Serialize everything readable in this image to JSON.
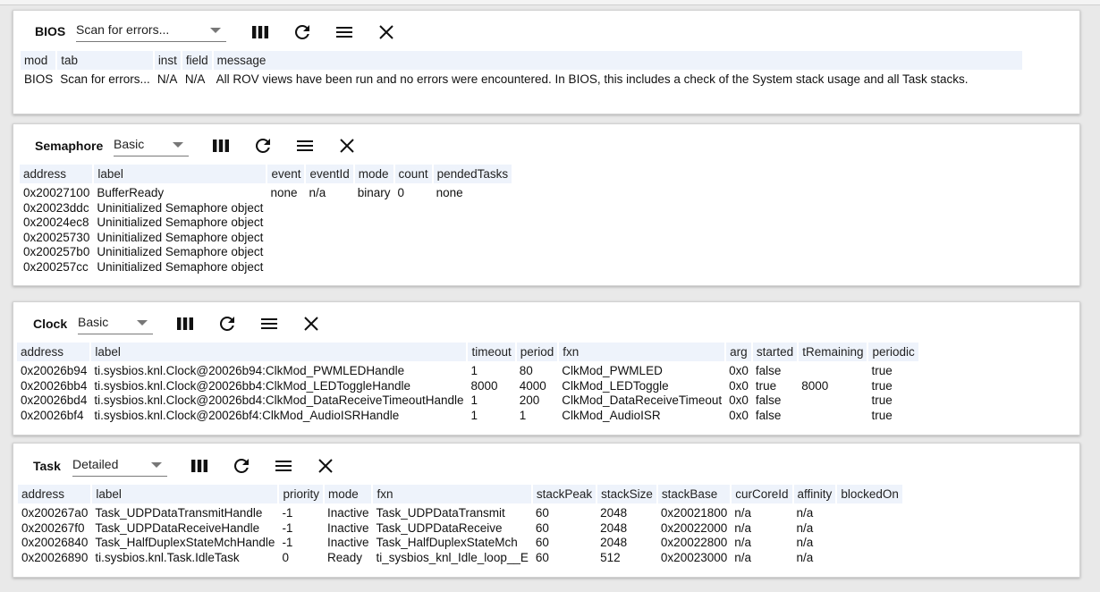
{
  "panels": {
    "bios": {
      "title": "BIOS",
      "view": "Scan for errors...",
      "columns": [
        "mod",
        "tab",
        "inst",
        "field",
        "message"
      ],
      "rows": [
        [
          "BIOS",
          "Scan for errors...",
          "N/A",
          "N/A",
          "All ROV views have been run and no errors were encountered. In BIOS, this includes a check of the System stack usage and all Task stacks."
        ]
      ]
    },
    "semaphore": {
      "title": "Semaphore",
      "view": "Basic",
      "columns": [
        "address",
        "label",
        "event",
        "eventId",
        "mode",
        "count",
        "pendedTasks"
      ],
      "rows": [
        [
          "0x20027100",
          "BufferReady",
          "none",
          "n/a",
          "binary",
          "0",
          "none"
        ],
        [
          "0x20023ddc",
          "Uninitialized Semaphore object",
          "",
          "",
          "",
          "",
          ""
        ],
        [
          "0x20024ec8",
          "Uninitialized Semaphore object",
          "",
          "",
          "",
          "",
          ""
        ],
        [
          "0x20025730",
          "Uninitialized Semaphore object",
          "",
          "",
          "",
          "",
          ""
        ],
        [
          "0x200257b0",
          "Uninitialized Semaphore object",
          "",
          "",
          "",
          "",
          ""
        ],
        [
          "0x200257cc",
          "Uninitialized Semaphore object",
          "",
          "",
          "",
          "",
          ""
        ]
      ]
    },
    "clock": {
      "title": "Clock",
      "view": "Basic",
      "columns": [
        "address",
        "label",
        "timeout",
        "period",
        "fxn",
        "arg",
        "started",
        "tRemaining",
        "periodic"
      ],
      "rows": [
        [
          "0x20026b94",
          "ti.sysbios.knl.Clock@20026b94:ClkMod_PWMLEDHandle",
          "1",
          "80",
          "ClkMod_PWMLED",
          "0x0",
          "false",
          "",
          "true"
        ],
        [
          "0x20026bb4",
          "ti.sysbios.knl.Clock@20026bb4:ClkMod_LEDToggleHandle",
          "8000",
          "4000",
          "ClkMod_LEDToggle",
          "0x0",
          "true",
          "8000",
          "true"
        ],
        [
          "0x20026bd4",
          "ti.sysbios.knl.Clock@20026bd4:ClkMod_DataReceiveTimeoutHandle",
          "1",
          "200",
          "ClkMod_DataReceiveTimeout",
          "0x0",
          "false",
          "",
          "true"
        ],
        [
          "0x20026bf4",
          "ti.sysbios.knl.Clock@20026bf4:ClkMod_AudioISRHandle",
          "1",
          "1",
          "ClkMod_AudioISR",
          "0x0",
          "false",
          "",
          "true"
        ]
      ]
    },
    "task": {
      "title": "Task",
      "view": "Detailed",
      "columns": [
        "address",
        "label",
        "priority",
        "mode",
        "fxn",
        "stackPeak",
        "stackSize",
        "stackBase",
        "curCoreId",
        "affinity",
        "blockedOn"
      ],
      "rows": [
        [
          "0x200267a0",
          "Task_UDPDataTransmitHandle",
          "-1",
          "Inactive",
          "Task_UDPDataTransmit",
          "60",
          "2048",
          "0x20021800",
          "n/a",
          "n/a",
          ""
        ],
        [
          "0x200267f0",
          "Task_UDPDataReceiveHandle",
          "-1",
          "Inactive",
          "Task_UDPDataReceive",
          "60",
          "2048",
          "0x20022000",
          "n/a",
          "n/a",
          ""
        ],
        [
          "0x20026840",
          "Task_HalfDuplexStateMchHandle",
          "-1",
          "Inactive",
          "Task_HalfDuplexStateMch",
          "60",
          "2048",
          "0x20022800",
          "n/a",
          "n/a",
          ""
        ],
        [
          "0x20026890",
          "ti.sysbios.knl.Task.IdleTask",
          "0",
          "Ready",
          "ti_sysbios_knl_Idle_loop__E",
          "60",
          "512",
          "0x20023000",
          "n/a",
          "n/a",
          ""
        ]
      ]
    }
  },
  "toolbar_icons": [
    "columns-icon",
    "refresh-icon",
    "menu-icon",
    "close-icon"
  ]
}
